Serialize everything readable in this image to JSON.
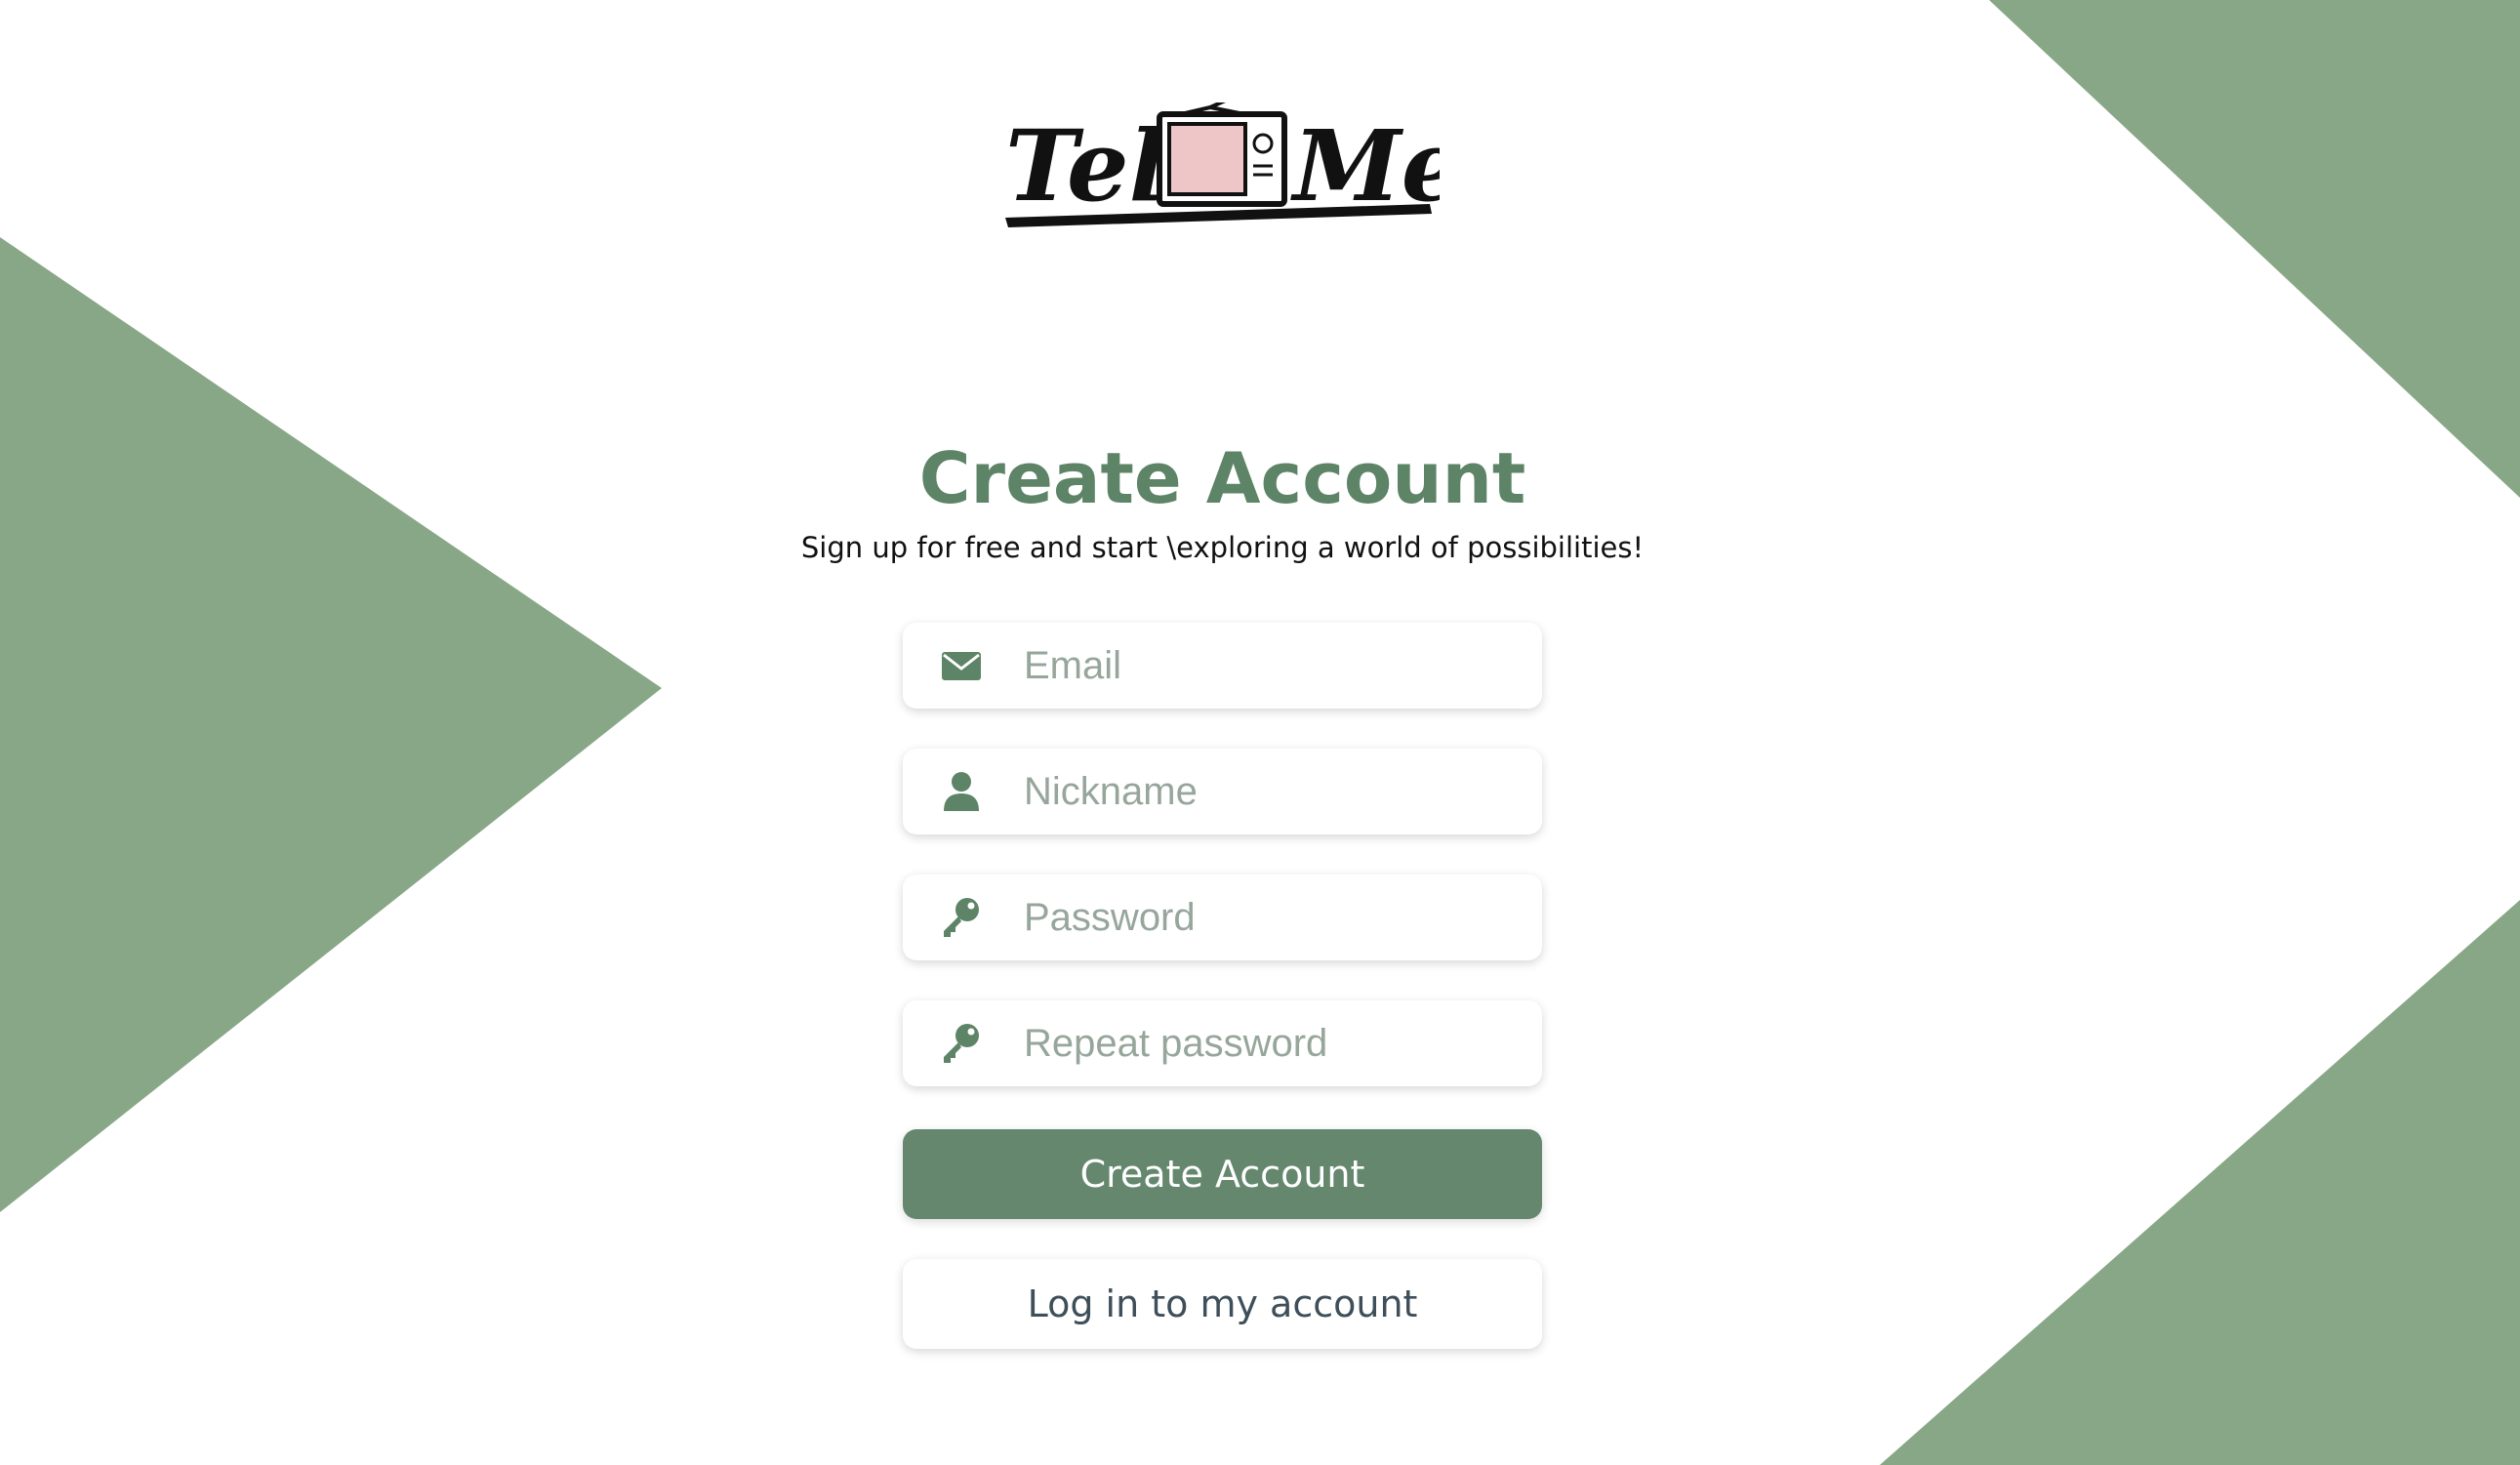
{
  "colors": {
    "accent": "#64876e",
    "title": "#5d8467",
    "background_shapes": "#88a787",
    "logo_screen": "#eec6c8",
    "placeholder": "#97a69b"
  },
  "logo": {
    "text_left": "Tel",
    "text_right": "Me",
    "icon": "tv-icon"
  },
  "header": {
    "title": "Create Account",
    "subtitle": "Sign up for free and start \\exploring a world of possibilities!"
  },
  "form": {
    "email": {
      "placeholder": "Email",
      "value": "",
      "icon": "envelope-icon"
    },
    "nickname": {
      "placeholder": "Nickname",
      "value": "",
      "icon": "user-icon"
    },
    "password": {
      "placeholder": "Password",
      "value": "",
      "icon": "key-icon"
    },
    "repeat_password": {
      "placeholder": "Repeat password",
      "value": "",
      "icon": "key-icon"
    }
  },
  "actions": {
    "create_label": "Create Account",
    "login_label": "Log in to my account"
  }
}
